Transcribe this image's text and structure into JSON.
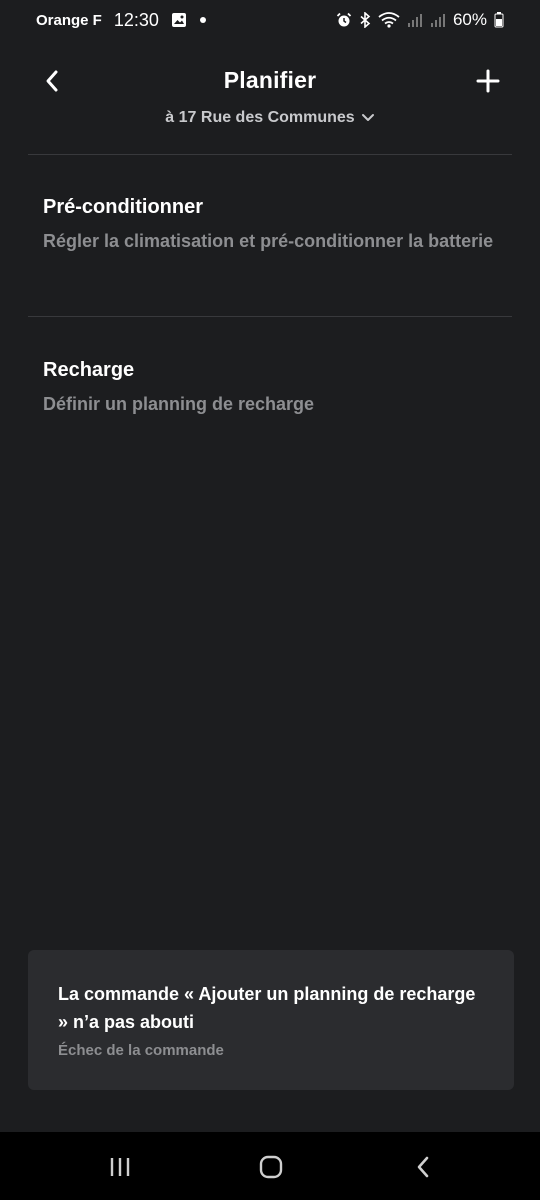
{
  "status_bar": {
    "carrier": "Orange F",
    "time": "12:30",
    "battery": "60%",
    "icons": [
      "image-icon",
      "dot-icon",
      "alarm-icon",
      "bluetooth-icon",
      "wifi-icon",
      "signal-icon",
      "signal-icon",
      "battery-icon"
    ]
  },
  "header": {
    "title": "Planifier",
    "location": "à 17 Rue des Communes"
  },
  "items": [
    {
      "title": "Pré-conditionner",
      "description": "Régler la climatisation et pré-conditionner la batterie"
    },
    {
      "title": "Recharge",
      "description": "Définir un planning de recharge"
    }
  ],
  "toast": {
    "message": "La commande « Ajouter un planning de recharge » n’a pas abouti",
    "detail": "Échec de la commande"
  },
  "colors": {
    "background": "#1c1d1f",
    "text_primary": "#ffffff",
    "text_secondary": "#8d8e91",
    "toast_background": "#2b2c2f"
  }
}
